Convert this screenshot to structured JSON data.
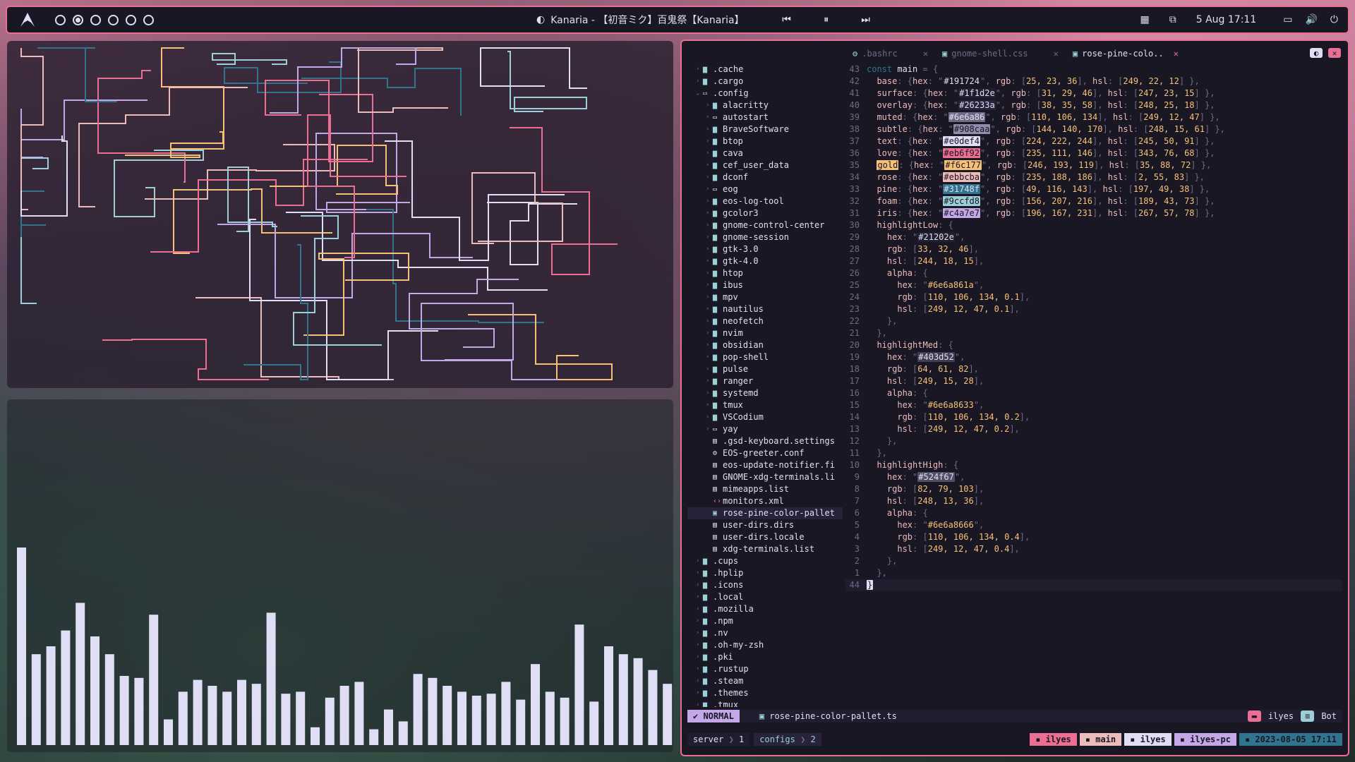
{
  "topbar": {
    "logo_icon": "arch-logo-icon",
    "workspaces": [
      false,
      true,
      false,
      false,
      false,
      false
    ],
    "media_title": "Kanaria - 【初音ミク】百鬼祭【Kanaria】",
    "prev_icon": "⏮",
    "pause_icon": "⏸",
    "next_icon": "⏭",
    "date": "5 Aug  17:11"
  },
  "editor": {
    "tabs": [
      {
        "icon": "⚙",
        "icon_color": "#9ccfd8",
        "label": ".bashrc"
      },
      {
        "icon": "▣",
        "icon_color": "#9ccfd8",
        "label": "gnome-shell.css"
      },
      {
        "icon": "▣",
        "icon_color": "#9ccfd8",
        "label": "rose-pine-colo.."
      }
    ],
    "tree": [
      {
        "indent": 0,
        "arrow": "›",
        "icon": "folder",
        "label": ".cache"
      },
      {
        "indent": 0,
        "arrow": "›",
        "icon": "folder",
        "label": ".cargo"
      },
      {
        "indent": 0,
        "arrow": "⌄",
        "icon": "folder-open",
        "label": ".config"
      },
      {
        "indent": 1,
        "arrow": "›",
        "icon": "folder",
        "label": "alacritty"
      },
      {
        "indent": 1,
        "arrow": "›",
        "icon": "folder-empty",
        "label": "autostart"
      },
      {
        "indent": 1,
        "arrow": "›",
        "icon": "folder",
        "label": "BraveSoftware"
      },
      {
        "indent": 1,
        "arrow": "›",
        "icon": "folder",
        "label": "btop"
      },
      {
        "indent": 1,
        "arrow": "›",
        "icon": "folder",
        "label": "cava"
      },
      {
        "indent": 1,
        "arrow": "›",
        "icon": "folder",
        "label": "cef_user_data"
      },
      {
        "indent": 1,
        "arrow": "›",
        "icon": "folder",
        "label": "dconf"
      },
      {
        "indent": 1,
        "arrow": "›",
        "icon": "folder-empty",
        "label": "eog"
      },
      {
        "indent": 1,
        "arrow": "›",
        "icon": "folder",
        "label": "eos-log-tool"
      },
      {
        "indent": 1,
        "arrow": "›",
        "icon": "folder",
        "label": "gcolor3"
      },
      {
        "indent": 1,
        "arrow": "›",
        "icon": "folder",
        "label": "gnome-control-center"
      },
      {
        "indent": 1,
        "arrow": "›",
        "icon": "folder",
        "label": "gnome-session"
      },
      {
        "indent": 1,
        "arrow": "›",
        "icon": "folder",
        "label": "gtk-3.0"
      },
      {
        "indent": 1,
        "arrow": "›",
        "icon": "folder",
        "label": "gtk-4.0"
      },
      {
        "indent": 1,
        "arrow": "›",
        "icon": "folder",
        "label": "htop"
      },
      {
        "indent": 1,
        "arrow": "›",
        "icon": "folder",
        "label": "ibus"
      },
      {
        "indent": 1,
        "arrow": "›",
        "icon": "folder",
        "label": "mpv"
      },
      {
        "indent": 1,
        "arrow": "›",
        "icon": "folder",
        "label": "nautilus"
      },
      {
        "indent": 1,
        "arrow": "›",
        "icon": "folder",
        "label": "neofetch"
      },
      {
        "indent": 1,
        "arrow": "›",
        "icon": "folder",
        "label": "nvim"
      },
      {
        "indent": 1,
        "arrow": "›",
        "icon": "folder",
        "label": "obsidian"
      },
      {
        "indent": 1,
        "arrow": "›",
        "icon": "folder",
        "label": "pop-shell"
      },
      {
        "indent": 1,
        "arrow": "›",
        "icon": "folder",
        "label": "pulse"
      },
      {
        "indent": 1,
        "arrow": "›",
        "icon": "folder",
        "label": "ranger"
      },
      {
        "indent": 1,
        "arrow": "›",
        "icon": "folder",
        "label": "systemd"
      },
      {
        "indent": 1,
        "arrow": "›",
        "icon": "folder",
        "label": "tmux"
      },
      {
        "indent": 1,
        "arrow": "›",
        "icon": "folder",
        "label": "VSCodium"
      },
      {
        "indent": 1,
        "arrow": "›",
        "icon": "folder-empty",
        "label": "yay"
      },
      {
        "indent": 1,
        "arrow": "",
        "icon": "file",
        "label": ".gsd-keyboard.settings"
      },
      {
        "indent": 1,
        "arrow": "",
        "icon": "gear",
        "label": "EOS-greeter.conf"
      },
      {
        "indent": 1,
        "arrow": "",
        "icon": "file",
        "label": "eos-update-notifier.fi"
      },
      {
        "indent": 1,
        "arrow": "",
        "icon": "file",
        "label": "GNOME-xdg-terminals.li"
      },
      {
        "indent": 1,
        "arrow": "",
        "icon": "file",
        "label": "mimeapps.list"
      },
      {
        "indent": 1,
        "arrow": "",
        "icon": "xml",
        "label": "monitors.xml"
      },
      {
        "indent": 1,
        "arrow": "",
        "icon": "ts",
        "label": "rose-pine-color-pallet",
        "selected": true
      },
      {
        "indent": 1,
        "arrow": "",
        "icon": "file",
        "label": "user-dirs.dirs"
      },
      {
        "indent": 1,
        "arrow": "",
        "icon": "file",
        "label": "user-dirs.locale"
      },
      {
        "indent": 1,
        "arrow": "",
        "icon": "file",
        "label": "xdg-terminals.list"
      },
      {
        "indent": 0,
        "arrow": "›",
        "icon": "folder",
        "label": ".cups"
      },
      {
        "indent": 0,
        "arrow": "›",
        "icon": "folder",
        "label": ".hplip"
      },
      {
        "indent": 0,
        "arrow": "›",
        "icon": "folder",
        "label": ".icons"
      },
      {
        "indent": 0,
        "arrow": "›",
        "icon": "folder",
        "label": ".local"
      },
      {
        "indent": 0,
        "arrow": "›",
        "icon": "folder",
        "label": ".mozilla"
      },
      {
        "indent": 0,
        "arrow": "›",
        "icon": "folder",
        "label": ".npm"
      },
      {
        "indent": 0,
        "arrow": "›",
        "icon": "folder",
        "label": ".nv"
      },
      {
        "indent": 0,
        "arrow": "›",
        "icon": "folder",
        "label": ".oh-my-zsh"
      },
      {
        "indent": 0,
        "arrow": "›",
        "icon": "folder",
        "label": ".pki"
      },
      {
        "indent": 0,
        "arrow": "›",
        "icon": "folder",
        "label": ".rustup"
      },
      {
        "indent": 0,
        "arrow": "›",
        "icon": "folder",
        "label": ".steam"
      },
      {
        "indent": 0,
        "arrow": "›",
        "icon": "folder",
        "label": ".themes"
      },
      {
        "indent": 0,
        "arrow": "›",
        "icon": "folder",
        "label": ".tmux"
      }
    ],
    "header_line": {
      "num": "43",
      "text": "const main = {"
    },
    "palette": [
      {
        "num": "42",
        "name": "base",
        "hex": "#191724",
        "rgb": "25, 23, 36",
        "hsl": "249, 22, 12",
        "sw": "#191724",
        "fg": "#e0def4"
      },
      {
        "num": "41",
        "name": "surface",
        "hex": "#1f1d2e",
        "rgb": "31, 29, 46",
        "hsl": "247, 23, 15",
        "sw": "#1f1d2e",
        "fg": "#e0def4"
      },
      {
        "num": "40",
        "name": "overlay",
        "hex": "#26233a",
        "rgb": "38, 35, 58",
        "hsl": "248, 25, 18",
        "sw": "#26233a",
        "fg": "#e0def4"
      },
      {
        "num": "39",
        "name": "muted",
        "hex": "#6e6a86",
        "rgb": "110, 106, 134",
        "hsl": "249, 12, 47",
        "sw": "#6e6a86",
        "fg": "#e0def4"
      },
      {
        "num": "38",
        "name": "subtle",
        "hex": "#908caa",
        "rgb": "144, 140, 170",
        "hsl": "248, 15, 61",
        "sw": "#908caa",
        "fg": "#191724"
      },
      {
        "num": "37",
        "name": "text",
        "hex": "#e0def4",
        "rgb": "224, 222, 244",
        "hsl": "245, 50, 91",
        "sw": "#e0def4",
        "fg": "#191724"
      },
      {
        "num": "36",
        "name": "love",
        "hex": "#eb6f92",
        "rgb": "235, 111, 146",
        "hsl": "343, 76, 68",
        "sw": "#eb6f92",
        "fg": "#191724"
      },
      {
        "num": "35",
        "name": "gold",
        "hex": "#f6c177",
        "rgb": "246, 193, 119",
        "hsl": "35, 88, 72",
        "sw": "#f6c177",
        "fg": "#191724",
        "namebg": "#f6c177"
      },
      {
        "num": "34",
        "name": "rose",
        "hex": "#ebbcba",
        "rgb": "235, 188, 186",
        "hsl": "2, 55, 83",
        "sw": "#ebbcba",
        "fg": "#191724"
      },
      {
        "num": "33",
        "name": "pine",
        "hex": "#31748f",
        "rgb": "49, 116, 143",
        "hsl": "197, 49, 38",
        "sw": "#31748f",
        "fg": "#e0def4"
      },
      {
        "num": "32",
        "name": "foam",
        "hex": "#9ccfd8",
        "rgb": "156, 207, 216",
        "hsl": "189, 43, 73",
        "sw": "#9ccfd8",
        "fg": "#191724"
      },
      {
        "num": "31",
        "name": "iris",
        "hex": "#c4a7e7",
        "rgb": "196, 167, 231",
        "hsl": "267, 57, 78",
        "sw": "#c4a7e7",
        "fg": "#191724"
      }
    ],
    "highlights": [
      {
        "name": "highlightLow",
        "start": "30",
        "hex": "#21202e",
        "rgb": "33, 32, 46",
        "hsl": "244, 18, 15",
        "alpha_hex": "#6e6a861a",
        "alpha_rgb": "110, 106, 134, 0.1",
        "alpha_hsl": "249, 12, 47, 0.1",
        "sw": "#21202e"
      },
      {
        "name": "highlightMed",
        "start": "20",
        "hex": "#403d52",
        "rgb": "64, 61, 82",
        "hsl": "249, 15, 28",
        "alpha_hex": "#6e6a8633",
        "alpha_rgb": "110, 106, 134, 0.2",
        "alpha_hsl": "249, 12, 47, 0.2",
        "sw": "#403d52"
      },
      {
        "name": "highlightHigh",
        "start": "10",
        "hex": "#524f67",
        "rgb": "82, 79, 103",
        "hsl": "248, 13, 36",
        "alpha_hex": "#6e6a8666",
        "alpha_rgb": "110, 106, 134, 0.4",
        "alpha_hsl": "249, 12, 47, 0.4",
        "sw": "#524f67"
      }
    ],
    "last_num": "44",
    "last_text": "}",
    "status": {
      "mode": "NORMAL",
      "file": "rose-pine-color-pallet.ts",
      "user": "ilyes",
      "pos": "Bot"
    },
    "tmux": {
      "session": "server",
      "win": "1",
      "win2_name": "configs",
      "win2": "2",
      "right": [
        {
          "label": "ilyes",
          "bg": "#eb6f92",
          "icon": "folder-icon"
        },
        {
          "label": "main",
          "bg": "#ebbcba",
          "icon": "branch-icon"
        },
        {
          "label": "ilyes",
          "bg": "#e0def4",
          "icon": "user-icon"
        },
        {
          "label": "ilyes-pc",
          "bg": "#c4a7e7",
          "icon": "host-icon"
        },
        {
          "label": "2023-08-05 17:11",
          "bg": "#31748f",
          "icon": "clock-icon"
        }
      ]
    }
  },
  "visualizer": {
    "bar_values": [
      1.0,
      0.46,
      0.5,
      0.58,
      0.72,
      0.55,
      0.46,
      0.35,
      0.34,
      0.66,
      0.13,
      0.27,
      0.33,
      0.3,
      0.27,
      0.33,
      0.31,
      0.67,
      0.26,
      0.27,
      0.09,
      0.24,
      0.3,
      0.32,
      0.08,
      0.18,
      0.12,
      0.36,
      0.34,
      0.3,
      0.27,
      0.25,
      0.26,
      0.32,
      0.23,
      0.41,
      0.27,
      0.24,
      0.61,
      0.22,
      0.5,
      0.46,
      0.44,
      0.38,
      0.31
    ]
  }
}
